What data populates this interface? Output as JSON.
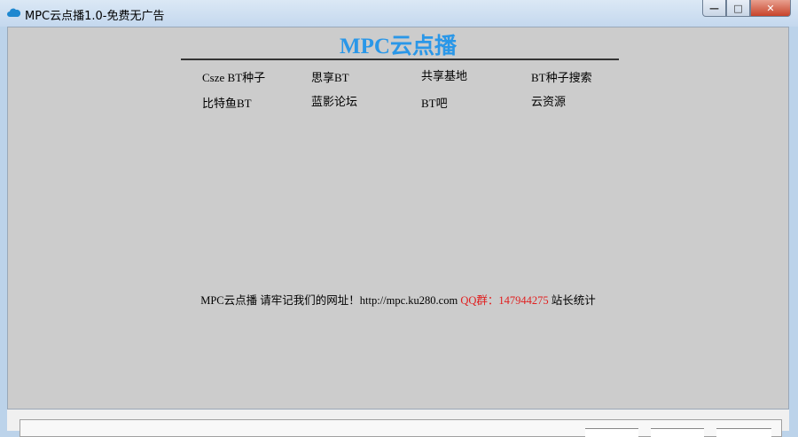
{
  "window": {
    "title": "MPC云点播1.0-免费无广告",
    "minimize": "—",
    "maximize": "□",
    "close": "✕"
  },
  "header": {
    "title": "MPC云点播"
  },
  "links": [
    {
      "label": "Csze BT种子"
    },
    {
      "label": "思享BT"
    },
    {
      "label": "共享基地"
    },
    {
      "label": "BT种子搜索"
    },
    {
      "label": "比特鱼BT"
    },
    {
      "label": "蓝影论坛"
    },
    {
      "label": "BT吧"
    },
    {
      "label": "云资源"
    }
  ],
  "footer": {
    "name": "MPC云点播",
    "remember": "请牢记我们的网址！",
    "url": "http://mpc.ku280.com",
    "qq_label": "QQ群：",
    "qq_number": "147944275",
    "stats": "站长统计"
  },
  "colors": {
    "accent": "#2a97e8",
    "red": "#e02020"
  }
}
